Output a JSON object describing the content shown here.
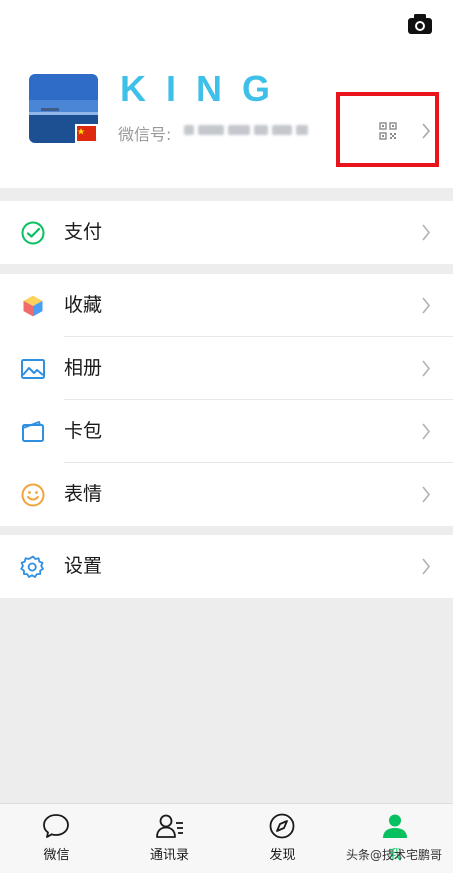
{
  "profile": {
    "nickname": "KING",
    "wechat_id_label": "微信号:",
    "wechat_id_value": "blurred"
  },
  "menu": {
    "pay": "支付",
    "favorites": "收藏",
    "album": "相册",
    "cards": "卡包",
    "stickers": "表情",
    "settings": "设置"
  },
  "tabs": [
    "微信",
    "通讯录",
    "发现",
    "我"
  ],
  "watermark": "头条@技术宅鹏哥",
  "colors": {
    "accent": "#07c160",
    "nickname": "#3fc0e8",
    "highlight": "#e8131b"
  },
  "icons": {
    "camera": "camera-icon",
    "qr": "qr-code-icon",
    "pay": "pay-check-icon",
    "favorites": "cube-icon",
    "album": "image-icon",
    "cards": "wallet-icon",
    "stickers": "smiley-icon",
    "settings": "gear-icon"
  }
}
